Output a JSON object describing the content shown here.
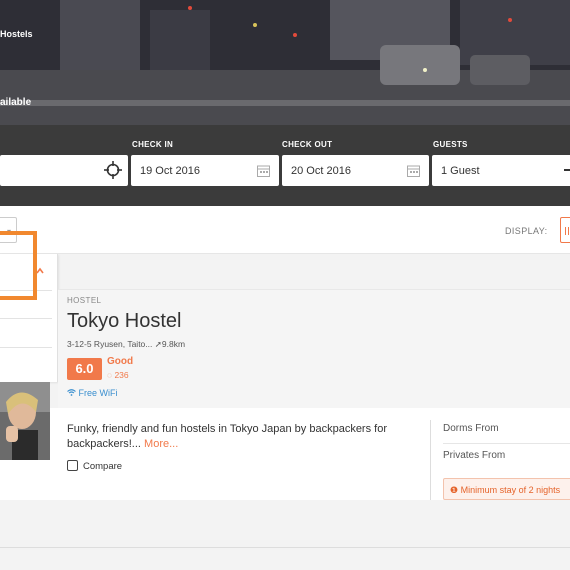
{
  "hero": {
    "breadcrumb": "Hostels",
    "availability": "ailable"
  },
  "search": {
    "check_in_label": "CHECK IN",
    "check_in_value": "19 Oct 2016",
    "check_out_label": "CHECK OUT",
    "check_out_value": "20 Oct 2016",
    "guests_label": "GUESTS",
    "guests_value": "1 Guest"
  },
  "toolbar": {
    "display_label": "DISPLAY:"
  },
  "listing": {
    "type": "HOSTEL",
    "name": "Tokyo Hostel",
    "address": "3-12-5 Ryusen, Taito...",
    "distance": "9.8km",
    "score": "6.0",
    "rating_word": "Good",
    "review_count": "236",
    "facility": "Free WiFi",
    "description": "Funky, friendly and fun hostels in Tokyo Japan by backpackers for backpackers!...",
    "more_link": "More...",
    "compare_label": "Compare",
    "dorms_label": "Dorms From",
    "privates_label": "Privates From",
    "min_stay": "Minimum stay of 2 nights"
  },
  "colors": {
    "accent": "#f1794a",
    "highlight": "#f1882e",
    "wifi": "#3a8fcf"
  }
}
